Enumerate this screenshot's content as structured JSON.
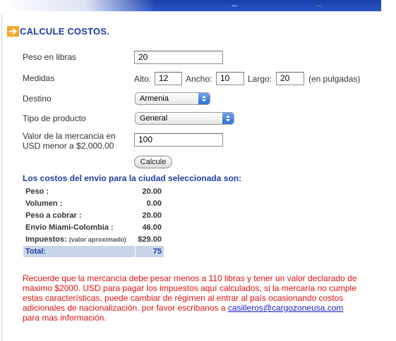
{
  "header": {
    "banner_left": "...",
    "banner_right": "..."
  },
  "form": {
    "title": "CALCULE COSTOS.",
    "peso_label": "Peso en libras",
    "peso_value": "20",
    "medidas_label": "Medidas",
    "alto_label": "Alto:",
    "alto_value": "12",
    "ancho_label": "Ancho:",
    "ancho_value": "10",
    "largo_label": "Largo:",
    "largo_value": "20",
    "medidas_unit": "(en pulgadas)",
    "destino_label": "Destino",
    "destino_value": "Armenia",
    "tipo_label": "Tipo de producto",
    "tipo_value": "General",
    "valor_label_1": "Valor de la mercancia en",
    "valor_label_2": "USD menor a $2,000.00",
    "valor_value": "100",
    "submit_label": "Calcule"
  },
  "results": {
    "title": "Los costos del envio para la ciudad seleccionada son:",
    "rows": [
      {
        "label": "Peso :",
        "value": "20.00"
      },
      {
        "label": "Volumen :",
        "value": "0.00"
      },
      {
        "label": "Peso a cobrar :",
        "value": "20.00"
      },
      {
        "label": "Envio Miami-Colombia :",
        "value": "46.00"
      },
      {
        "label": "Impuestos:",
        "note": "(valor aproximado)",
        "value": "$29.00"
      }
    ],
    "total_label": "Total:",
    "total_value": "75"
  },
  "notice": {
    "text": "Recuerde que la mercancía debe pesar menos a 110 libras y tener un valor declarado de máximo $2000. USD para pagar los impuestos aquí calculados, si la mercaría no cumple estas características, puede cambiar de régimen al entrar al país ocasionando costos adicionales de nacionalización. por favor escribanos a ",
    "email": "casilleros@cargozoneusa.com",
    "tail": "para mas información."
  },
  "colors": {
    "accent_blue": "#1e3ea3",
    "warning_red": "#e01010",
    "link_blue": "#1a1ac8",
    "total_bg": "#c9d6ea",
    "arrow_orange": "#f2a82c"
  },
  "icons": {
    "title_icon": "arrow-right-icon",
    "select_icon": "updown-arrows-icon"
  }
}
